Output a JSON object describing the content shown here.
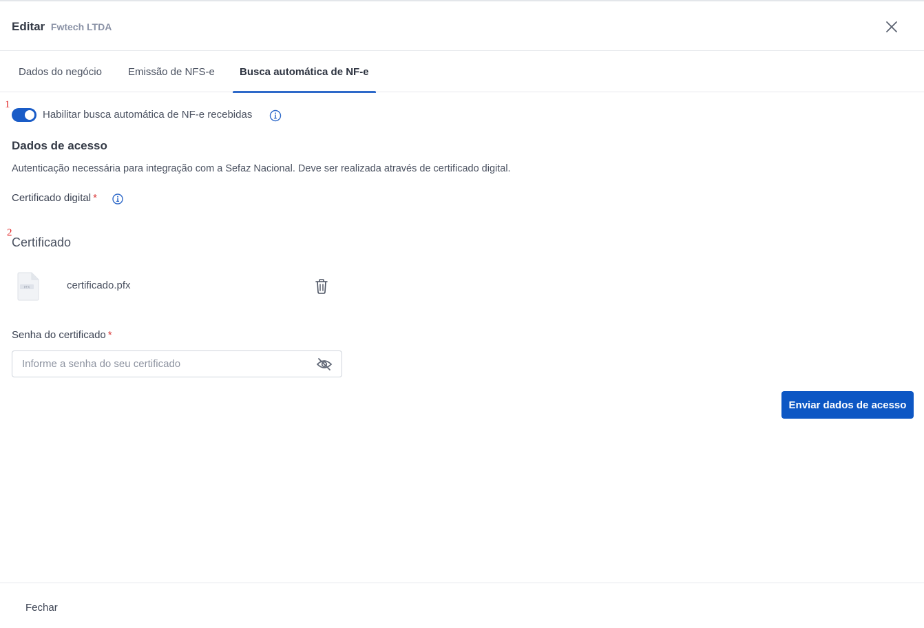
{
  "header": {
    "title": "Editar",
    "company": "Fwtech LTDA",
    "close_icon": "close-icon"
  },
  "tabs": [
    {
      "label": "Dados do negócio",
      "active": false
    },
    {
      "label": "Emissão de NFS-e",
      "active": false
    },
    {
      "label": "Busca automática de NF-e",
      "active": true
    }
  ],
  "markers": [
    "1",
    "2"
  ],
  "toggle": {
    "label": "Habilitar busca automática de NF-e recebidas",
    "enabled": true,
    "color": "#1a5cc7"
  },
  "access": {
    "title": "Dados de acesso",
    "description": "Autenticação necessária para integração com a Sefaz Nacional. Deve ser realizada através de certificado digital.",
    "certificate_label": "Certificado digital",
    "required_mark": "*"
  },
  "certificate": {
    "heading": "Certificado",
    "file_name": "certificado.pfx",
    "file_icon": "file-pfx-icon",
    "delete_icon": "trash-icon"
  },
  "password": {
    "label": "Senha do certificado",
    "required_mark": "*",
    "placeholder": "Informe a senha do seu certificado",
    "value": "",
    "visibility_icon": "eye-slash-icon"
  },
  "actions": {
    "submit_label": "Enviar dados de acesso",
    "submit_color": "#0d57c4"
  },
  "footer": {
    "close_label": "Fechar"
  }
}
